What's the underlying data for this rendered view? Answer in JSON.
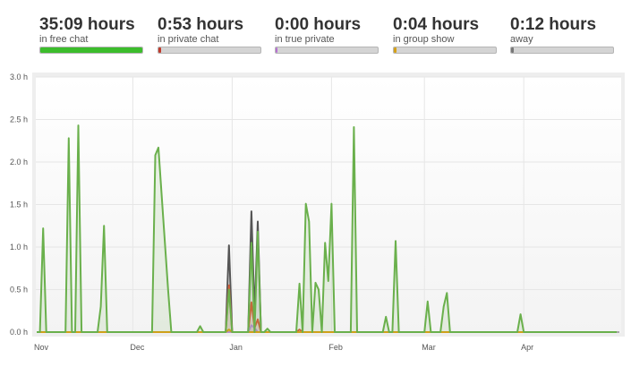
{
  "stats": [
    {
      "value": "35:09 hours",
      "label": "in free chat",
      "fill": 1.0,
      "color": "#3cbd2c"
    },
    {
      "value": "0:53 hours",
      "label": "in private chat",
      "fill": 0.03,
      "color": "#c0392b"
    },
    {
      "value": "0:00 hours",
      "label": "in true private",
      "fill": 0.02,
      "color": "#b66fd1"
    },
    {
      "value": "0:04 hours",
      "label": "in group show",
      "fill": 0.025,
      "color": "#d4a017"
    },
    {
      "value": "0:12 hours",
      "label": "away",
      "fill": 0.025,
      "color": "#777777"
    }
  ],
  "chart_data": {
    "type": "area",
    "ylim": [
      0,
      3.0
    ],
    "y_ticks": [
      "0.0 h",
      "0.5 h",
      "1.0 h",
      "1.5 h",
      "2.0 h",
      "2.5 h",
      "3.0 h"
    ],
    "y_tick_values": [
      0,
      0.5,
      1.0,
      1.5,
      2.0,
      2.5,
      3.0
    ],
    "x_range": [
      "2011-11-01",
      "2012-04-30"
    ],
    "x_ticks": [
      {
        "label": "Nov",
        "date": "2011-11-01"
      },
      {
        "label": "Dec",
        "date": "2011-12-01"
      },
      {
        "label": "Jan",
        "date": "2012-01-01"
      },
      {
        "label": "Feb",
        "date": "2012-02-01"
      },
      {
        "label": "Mar",
        "date": "2012-03-01"
      },
      {
        "label": "Apr",
        "date": "2012-04-01"
      }
    ],
    "grid": true,
    "series": [
      {
        "color": "#555555",
        "points": [
          [
            "2011-11-01",
            0
          ],
          [
            "2011-12-30",
            0
          ],
          [
            "2011-12-31",
            1.02
          ],
          [
            "2012-01-01",
            0
          ],
          [
            "2012-01-06",
            0
          ],
          [
            "2012-01-07",
            1.42
          ],
          [
            "2012-01-08",
            0.2
          ],
          [
            "2012-01-09",
            1.3
          ],
          [
            "2012-01-10",
            0
          ],
          [
            "2012-04-30",
            0
          ]
        ]
      },
      {
        "color": "#d35f3a",
        "points": [
          [
            "2011-11-01",
            0
          ],
          [
            "2011-12-30",
            0
          ],
          [
            "2011-12-31",
            0.55
          ],
          [
            "2012-01-01",
            0
          ],
          [
            "2012-01-06",
            0
          ],
          [
            "2012-01-07",
            0.35
          ],
          [
            "2012-01-08",
            0.05
          ],
          [
            "2012-01-09",
            0.15
          ],
          [
            "2012-01-10",
            0
          ],
          [
            "2012-01-21",
            0
          ],
          [
            "2012-01-22",
            0.03
          ],
          [
            "2012-01-23",
            0
          ],
          [
            "2012-04-30",
            0
          ]
        ]
      },
      {
        "color": "#b58fd0",
        "points": [
          [
            "2011-11-01",
            0
          ],
          [
            "2012-01-06",
            0
          ],
          [
            "2012-01-07",
            0.08
          ],
          [
            "2012-01-08",
            0.05
          ],
          [
            "2012-01-09",
            0
          ],
          [
            "2012-04-30",
            0
          ]
        ]
      },
      {
        "color": "#d4a017",
        "points": [
          [
            "2011-11-01",
            0
          ],
          [
            "2011-12-30",
            0
          ],
          [
            "2011-12-31",
            0.03
          ],
          [
            "2012-01-01",
            0
          ],
          [
            "2012-04-30",
            0
          ]
        ]
      },
      {
        "color": "#6ab04c",
        "points": [
          [
            "2011-11-01",
            0
          ],
          [
            "2011-11-02",
            0
          ],
          [
            "2011-11-03",
            1.22
          ],
          [
            "2011-11-04",
            0
          ],
          [
            "2011-11-10",
            0
          ],
          [
            "2011-11-11",
            2.28
          ],
          [
            "2011-11-12",
            0
          ],
          [
            "2011-11-13",
            0
          ],
          [
            "2011-11-14",
            2.43
          ],
          [
            "2011-11-15",
            0
          ],
          [
            "2011-11-20",
            0
          ],
          [
            "2011-11-21",
            0.3
          ],
          [
            "2011-11-22",
            1.25
          ],
          [
            "2011-11-23",
            0
          ],
          [
            "2011-12-07",
            0
          ],
          [
            "2011-12-08",
            2.08
          ],
          [
            "2011-12-09",
            2.17
          ],
          [
            "2011-12-12",
            0.5
          ],
          [
            "2011-12-13",
            0
          ],
          [
            "2011-12-21",
            0
          ],
          [
            "2011-12-22",
            0.07
          ],
          [
            "2011-12-23",
            0
          ],
          [
            "2011-12-30",
            0
          ],
          [
            "2011-12-31",
            0.5
          ],
          [
            "2012-01-01",
            0
          ],
          [
            "2012-01-06",
            0
          ],
          [
            "2012-01-07",
            1.05
          ],
          [
            "2012-01-08",
            0
          ],
          [
            "2012-01-09",
            1.18
          ],
          [
            "2012-01-10",
            0
          ],
          [
            "2012-01-11",
            0
          ],
          [
            "2012-01-12",
            0.04
          ],
          [
            "2012-01-13",
            0
          ],
          [
            "2012-01-21",
            0
          ],
          [
            "2012-01-22",
            0.57
          ],
          [
            "2012-01-23",
            0
          ],
          [
            "2012-01-24",
            1.51
          ],
          [
            "2012-01-25",
            1.3
          ],
          [
            "2012-01-26",
            0
          ],
          [
            "2012-01-27",
            0.58
          ],
          [
            "2012-01-28",
            0.5
          ],
          [
            "2012-01-29",
            0
          ],
          [
            "2012-01-30",
            1.05
          ],
          [
            "2012-01-31",
            0.6
          ],
          [
            "2012-02-01",
            1.51
          ],
          [
            "2012-02-02",
            0
          ],
          [
            "2012-02-07",
            0
          ],
          [
            "2012-02-08",
            2.41
          ],
          [
            "2012-02-09",
            0
          ],
          [
            "2012-02-17",
            0
          ],
          [
            "2012-02-18",
            0.18
          ],
          [
            "2012-02-19",
            0
          ],
          [
            "2012-02-20",
            0
          ],
          [
            "2012-02-21",
            1.07
          ],
          [
            "2012-02-22",
            0
          ],
          [
            "2012-03-01",
            0
          ],
          [
            "2012-03-02",
            0.36
          ],
          [
            "2012-03-03",
            0
          ],
          [
            "2012-03-06",
            0
          ],
          [
            "2012-03-07",
            0.3
          ],
          [
            "2012-03-08",
            0.46
          ],
          [
            "2012-03-09",
            0
          ],
          [
            "2012-03-30",
            0
          ],
          [
            "2012-03-31",
            0.21
          ],
          [
            "2012-04-01",
            0
          ],
          [
            "2012-04-30",
            0
          ]
        ]
      }
    ]
  }
}
